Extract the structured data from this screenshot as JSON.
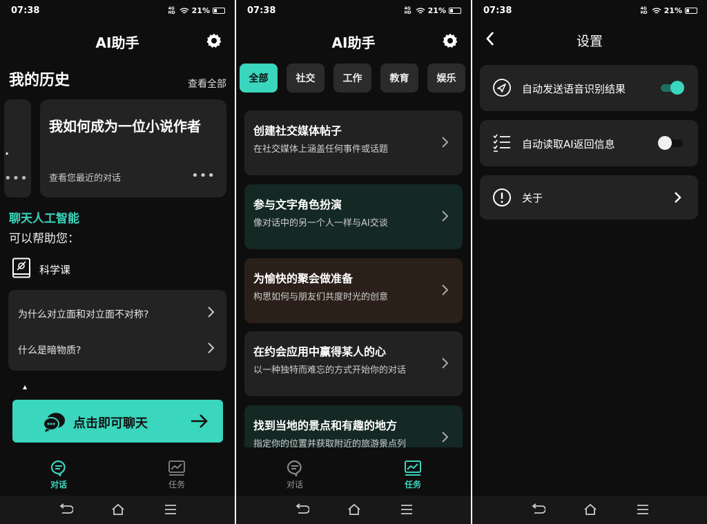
{
  "status": {
    "time": "07:38",
    "battery": "21%",
    "signal": "4G HD"
  },
  "panel1": {
    "app_title": "AI助手",
    "history_title": "我的历史",
    "see_all": "查看全部",
    "partial_card_char": ".",
    "main_card": {
      "title": "我如何成为一位小说作者",
      "subtitle": "查看您最近的对话"
    },
    "chat_ai": "聊天人工智能",
    "help": "可以帮助您：",
    "category": "科学课",
    "questions": [
      "为什么对立面和对立面不对称?",
      "什么是暗物质?"
    ],
    "cta": "点击即可聊天",
    "tabs": [
      {
        "label": "对话",
        "active": true
      },
      {
        "label": "任务",
        "active": false
      }
    ]
  },
  "panel2": {
    "app_title": "AI助手",
    "chips": [
      "全部",
      "社交",
      "工作",
      "教育",
      "娱乐"
    ],
    "tasks": [
      {
        "title": "创建社交媒体帖子",
        "subtitle": "在社交媒体上涵盖任何事件或话题",
        "bg": "#222222"
      },
      {
        "title": "参与文字角色扮演",
        "subtitle": "像对话中的另一个人一样与AI交谈",
        "bg": "#142824"
      },
      {
        "title": "为愉快的聚会做准备",
        "subtitle": "构思如何与朋友们共度时光的创意",
        "bg": "#2a2019"
      },
      {
        "title": "在约会应用中赢得某人的心",
        "subtitle": "以一种独特而难忘的方式开始你的对话",
        "bg": "#222222"
      },
      {
        "title": "找到当地的景点和有趣的地方",
        "subtitle": "指定你的位置并获取附近的旅游景点列",
        "bg": "#142824"
      }
    ],
    "tabs": [
      {
        "label": "对话",
        "active": false
      },
      {
        "label": "任务",
        "active": true
      }
    ]
  },
  "panel3": {
    "title": "设置",
    "rows": [
      {
        "label": "自动发送语音识别结果",
        "toggle": true
      },
      {
        "label": "自动读取AI返回信息",
        "toggle": false
      },
      {
        "label": "关于"
      }
    ]
  },
  "colors": {
    "accent": "#3ad6bd",
    "background": "#0e0e0e",
    "card": "#232323"
  }
}
